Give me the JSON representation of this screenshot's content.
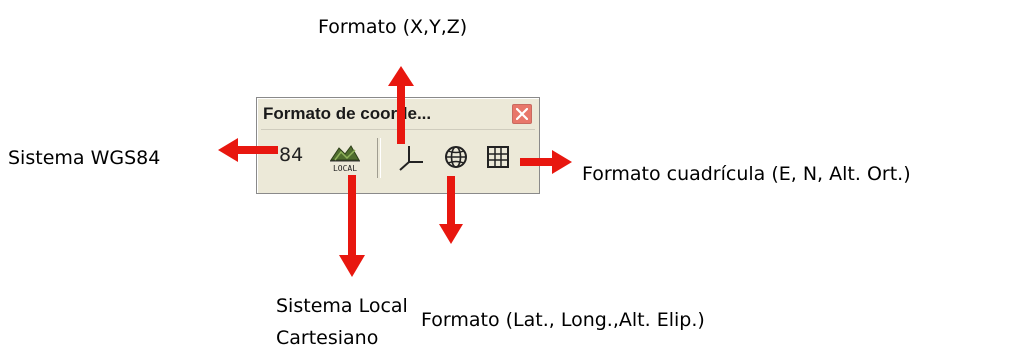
{
  "window": {
    "title": "Formato de coorde...",
    "close_icon": "close-icon"
  },
  "toolbar": {
    "wgs84_label": "84",
    "local_label": "LOCAL",
    "icons": [
      "wgs84-icon",
      "local-cartesian-icon",
      "xyz-axes-icon",
      "globe-icon",
      "grid-icon"
    ]
  },
  "callouts": {
    "xyz": "Formato (X,Y,Z)",
    "wgs84": "Sistema WGS84",
    "grid": "Formato cuadrícula (E, N, Alt. Ort.)",
    "latlong": "Formato (Lat., Long.,Alt. Elip.)",
    "local_line1": "Sistema Local",
    "local_line2": "Cartesiano"
  },
  "colors": {
    "arrow": "#e8170f",
    "panel": "#ece9d8",
    "close_button": "#e8776a"
  }
}
